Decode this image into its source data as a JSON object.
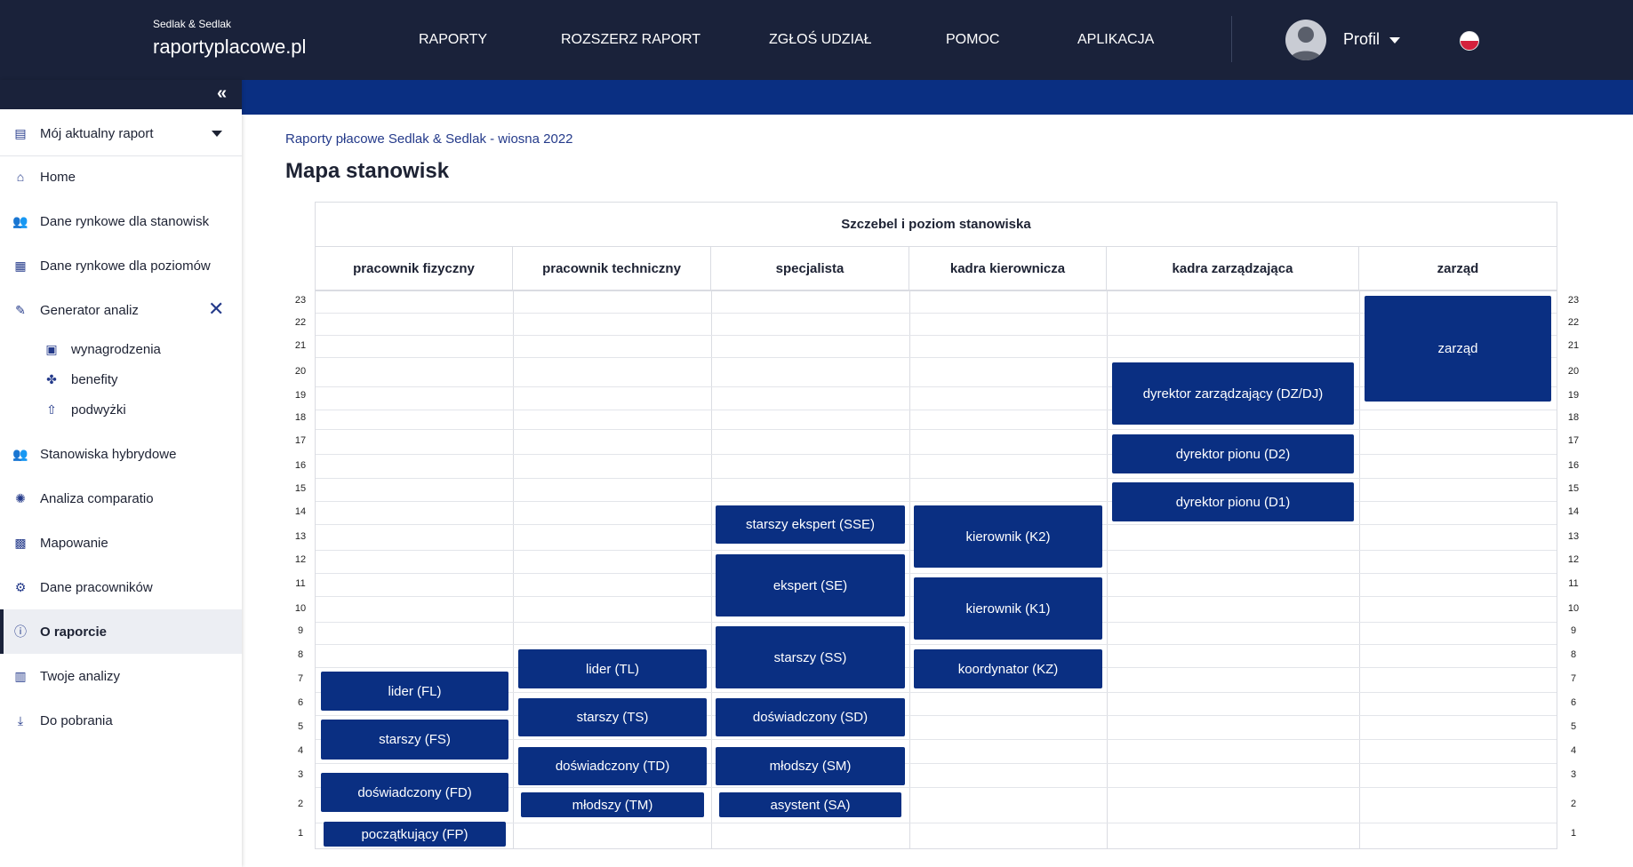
{
  "header": {
    "brand_small": "Sedlak & Sedlak",
    "brand": "raportyplacowe.pl",
    "nav": [
      "RAPORTY",
      "ROZSZERZ RAPORT",
      "ZGŁOŚ UDZIAŁ",
      "POMOC",
      "APLIKACJA"
    ],
    "profile": "Profil"
  },
  "sidebar": {
    "items": [
      {
        "label": "Mój aktualny raport",
        "icon": "report-icon"
      },
      {
        "label": "Home",
        "icon": "home-icon"
      },
      {
        "label": "Dane rynkowe dla stanowisk",
        "icon": "people-icon"
      },
      {
        "label": "Dane rynkowe dla poziomów",
        "icon": "document-icon"
      },
      {
        "label": "Generator analiz",
        "icon": "wand-icon"
      },
      {
        "label": "wynagrodzenia",
        "icon": "money-icon"
      },
      {
        "label": "benefity",
        "icon": "benefits-icon"
      },
      {
        "label": "podwyżki",
        "icon": "raise-icon"
      },
      {
        "label": "Stanowiska hybrydowe",
        "icon": "people-icon"
      },
      {
        "label": "Analiza comparatio",
        "icon": "bulb-icon"
      },
      {
        "label": "Mapowanie",
        "icon": "map-icon"
      },
      {
        "label": "Dane pracowników",
        "icon": "gear-icon"
      },
      {
        "label": "O raporcie",
        "icon": "info-icon"
      },
      {
        "label": "Twoje analizy",
        "icon": "analysis-icon"
      },
      {
        "label": "Do pobrania",
        "icon": "download-icon"
      }
    ]
  },
  "main": {
    "breadcrumb": "Raporty płacowe Sedlak & Sedlak - wiosna 2022",
    "title": "Mapa stanowisk",
    "grid_title": "Szczebel i poziom stanowiska",
    "columns": [
      "pracownik fizyczny",
      "pracownik techniczny",
      "specjalista",
      "kadra kierownicza",
      "kadra zarządzająca",
      "zarząd"
    ],
    "levels": [
      "23",
      "22",
      "21",
      "20",
      "19",
      "18",
      "17",
      "16",
      "15",
      "14",
      "13",
      "12",
      "11",
      "10",
      "9",
      "8",
      "7",
      "6",
      "5",
      "4",
      "3",
      "2",
      "1"
    ],
    "positions": [
      "zarząd",
      "dyrektor zarządzający (DZ/DJ)",
      "dyrektor pionu (D2)",
      "dyrektor pionu (D1)",
      "starszy ekspert (SSE)",
      "kierownik (K2)",
      "ekspert (SE)",
      "kierownik (K1)",
      "starszy (SS)",
      "koordynator (KZ)",
      "lider (TL)",
      "lider (FL)",
      "starszy (TS)",
      "doświadczony (SD)",
      "starszy (FS)",
      "doświadczony (TD)",
      "młodszy (SM)",
      "doświadczony (FD)",
      "młodszy (TM)",
      "asystent (SA)",
      "początkujący (FP)"
    ]
  }
}
